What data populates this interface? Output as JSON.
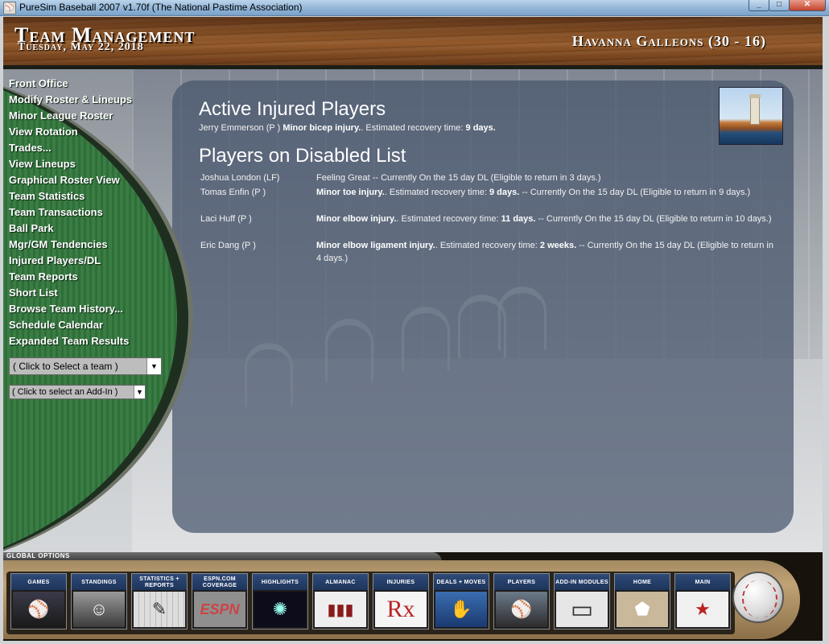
{
  "window": {
    "title": "PureSim Baseball 2007 v1.70f (The National Pastime Association)",
    "minimize": "_",
    "maximize": "□",
    "close": "✕"
  },
  "header": {
    "title": "Team Management",
    "date": "Tuesday, May 22, 2018",
    "team": "Havanna Galleons (30 - 16)"
  },
  "sidebar": {
    "items": [
      {
        "label": "Front Office"
      },
      {
        "label": "Modify Roster & Lineups"
      },
      {
        "label": "Minor League Roster"
      },
      {
        "label": "View Rotation"
      },
      {
        "label": "Trades..."
      },
      {
        "label": "View Lineups"
      },
      {
        "label": "Graphical Roster View"
      },
      {
        "label": "Team Statistics"
      },
      {
        "label": "Team Transactions"
      },
      {
        "label": "Ball Park"
      },
      {
        "label": "Mgr/GM Tendencies"
      },
      {
        "label": "Injured Players/DL"
      },
      {
        "label": "Team Reports"
      },
      {
        "label": "Short List"
      },
      {
        "label": "Browse Team History..."
      },
      {
        "label": "Schedule Calendar"
      },
      {
        "label": "Expanded Team Results"
      }
    ],
    "team_select": "( Click to Select a team )",
    "addin_select": "( Click to select an Add-In )"
  },
  "injured": {
    "heading": "Active Injured Players",
    "players": [
      {
        "name": "Jerry Emmerson (P )",
        "injury": "Minor bicep injury.",
        "mid": ". Estimated recovery time:",
        "time": "9 days."
      }
    ]
  },
  "disabled": {
    "heading": "Players on Disabled List",
    "rows": [
      {
        "name": "Joshua London (LF)",
        "injury": "",
        "pre": "Feeling Great -- Currently On the 15 day DL (Eligible to return in 3 days.)",
        "time": "",
        "post": ""
      },
      {
        "name": "Tomas Enfin (P )",
        "injury": "Minor toe injury.",
        "pre": ". Estimated recovery time: ",
        "time": "9 days.",
        "post": " -- Currently On the 15 day DL (Eligible to return in 9 days.)"
      },
      {
        "name": "Laci Huff (P )",
        "injury": "Minor elbow injury.",
        "pre": ". Estimated recovery time: ",
        "time": "11 days.",
        "post": " -- Currently On the 15 day DL (Eligible to return in 10 days.)"
      },
      {
        "name": "Eric Dang (P )",
        "injury": "Minor elbow ligament injury.",
        "pre": ". Estimated recovery time: ",
        "time": "2 weeks.",
        "post": " -- Currently On the 15 day DL (Eligible to return in 4 days.)"
      }
    ]
  },
  "global_options": {
    "label": "Global Options",
    "buttons": [
      {
        "label": "GAMES",
        "icon": "pitcher-icon",
        "glyph": "⚾"
      },
      {
        "label": "STANDINGS",
        "icon": "manager-icon",
        "glyph": "☺"
      },
      {
        "label": "STATISTICS + REPORTS",
        "icon": "statistics-icon",
        "glyph": "✎"
      },
      {
        "label": "ESPN.COM COVERAGE",
        "icon": "espn-icon",
        "glyph": "ESPN"
      },
      {
        "label": "HIGHLIGHTS",
        "icon": "fireworks-icon",
        "glyph": "✺"
      },
      {
        "label": "ALMANAC",
        "icon": "books-icon",
        "glyph": "▮▮▮"
      },
      {
        "label": "INJURIES",
        "icon": "rx-icon",
        "glyph": "Rx"
      },
      {
        "label": "DEALS + MOVES",
        "icon": "handshake-icon",
        "glyph": "✋"
      },
      {
        "label": "PLAYERS",
        "icon": "batter-icon",
        "glyph": "⚾"
      },
      {
        "label": "ADD-IN MODULES",
        "icon": "laptop-icon",
        "glyph": "▭"
      },
      {
        "label": "HOME",
        "icon": "home-plate-icon",
        "glyph": "⬟"
      },
      {
        "label": "MAIN",
        "icon": "main-logo-icon",
        "glyph": "★"
      }
    ]
  }
}
